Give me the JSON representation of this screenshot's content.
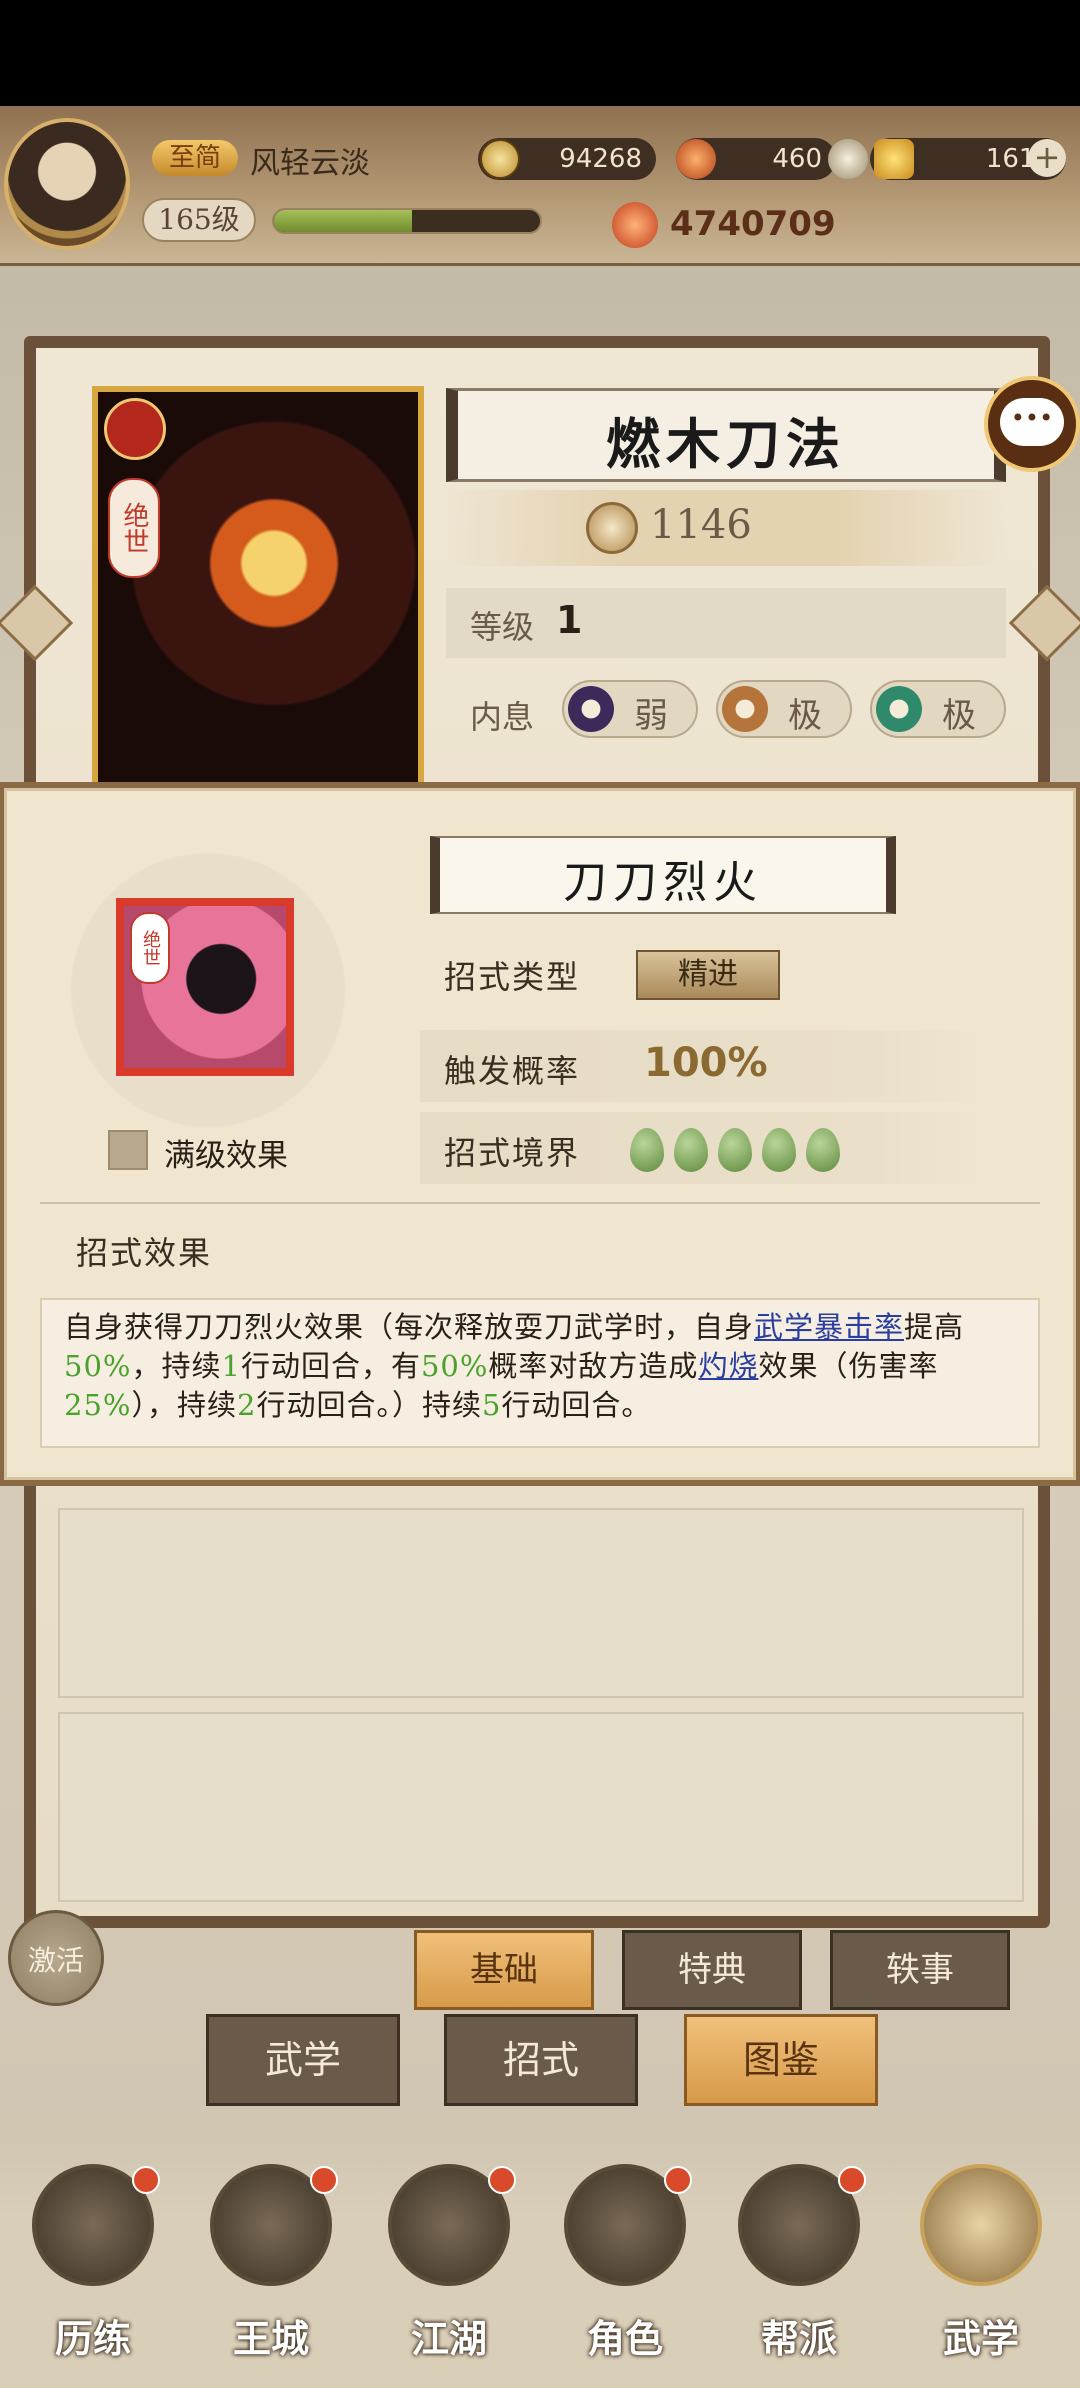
{
  "header": {
    "vip_label": "至简",
    "player_name": "风轻云淡",
    "level": "165级",
    "exp_fraction": 0.52,
    "coins": "94268",
    "stamina": "460",
    "gold": "1613",
    "combat_power": "4740709"
  },
  "skill_card": {
    "name": "燃木刀法",
    "rarity_tag": "绝世",
    "power": "1146",
    "level_label": "等级",
    "level": "1",
    "neixi_label": "内息",
    "neixi": [
      {
        "text": "弱",
        "color": "#3b2a5a"
      },
      {
        "text": "极",
        "color": "#b5743a"
      },
      {
        "text": "极",
        "color": "#2e8a6a"
      }
    ]
  },
  "popup": {
    "title": "刀刀烈火",
    "icon_tag": "绝世",
    "max_level_label": "满级效果",
    "attrs": {
      "type_label": "招式类型",
      "type_value": "精进",
      "rate_label": "触发概率",
      "rate_value": "100%",
      "realm_label": "招式境界",
      "realm_level": 5
    },
    "effect_heading": "招式效果",
    "effect": {
      "p1": "自身获得刀刀烈火效果（每次释放耍刀武学时，自身",
      "link1": "武学暴击率",
      "p2": "提高",
      "n1": "50%",
      "p3": "，持续",
      "n2": "1",
      "p4": "行动回合，有",
      "n3": "50%",
      "p5": "概率对敌方造成",
      "link2": "灼烧",
      "p6": "效果（伤害率",
      "n4": "25%",
      "p7": "），持续",
      "n5": "2",
      "p8": "行动回合。）持续",
      "n6": "5",
      "p9": "行动回合。"
    }
  },
  "activate_label": "激活",
  "sub_tabs": [
    "基础",
    "特典",
    "轶事"
  ],
  "main_tabs": [
    "武学",
    "招式",
    "图鉴"
  ],
  "nav": [
    "历练",
    "王城",
    "江湖",
    "角色",
    "帮派",
    "武学"
  ]
}
